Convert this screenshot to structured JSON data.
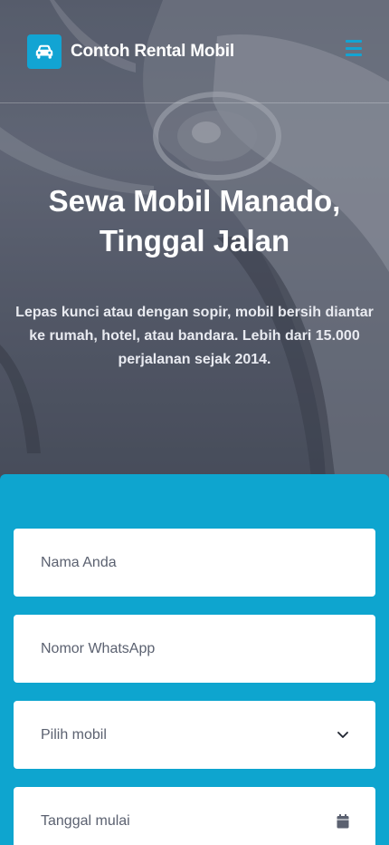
{
  "brand": {
    "name": "Contoh Rental Mobil",
    "logo_icon": "car-icon"
  },
  "nav": {
    "menu_icon": "hamburger-menu-icon"
  },
  "hero": {
    "title_line1": "Sewa Mobil Manado,",
    "title_line2": "Tinggal Jalan",
    "subtitle_line1": "Lepas kunci atau dengan sopir, mobil bersih diantar",
    "subtitle_line2": "ke rumah, hotel, atau bandara. Lebih dari 15.000",
    "subtitle_line3": "perjalanan sejak 2014."
  },
  "form": {
    "name_placeholder": "Nama Anda",
    "whatsapp_placeholder": "Nomor WhatsApp",
    "car_select_value": "Pilih mobil",
    "car_select_icon": "chevron-down-icon",
    "start_date_placeholder": "Tanggal mulai",
    "start_date_icon": "calendar-icon"
  },
  "colors": {
    "accent": "#12a4d3",
    "panel": "#0ea5cf",
    "field_bg": "#ffffff",
    "field_text": "#5b6170"
  }
}
